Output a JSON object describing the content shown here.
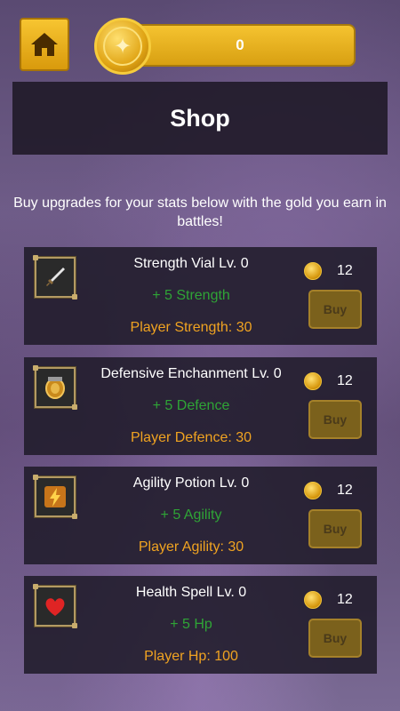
{
  "header": {
    "gold": "0"
  },
  "shop": {
    "title": "Shop",
    "description": "Buy upgrades for your stats below with the gold you earn in battles!"
  },
  "items": [
    {
      "title": "Strength Vial Lv. 0",
      "bonus": "+ 5 Strength",
      "stat": "Player Strength: 30",
      "price": "12",
      "buy_label": "Buy",
      "icon": "sword-icon"
    },
    {
      "title": "Defensive Enchanment Lv. 0",
      "bonus": "+ 5 Defence",
      "stat": "Player Defence: 30",
      "price": "12",
      "buy_label": "Buy",
      "icon": "shield-icon"
    },
    {
      "title": "Agility Potion Lv. 0",
      "bonus": "+ 5 Agility",
      "stat": "Player Agility: 30",
      "price": "12",
      "buy_label": "Buy",
      "icon": "lightning-icon"
    },
    {
      "title": "Health Spell Lv. 0",
      "bonus": "+ 5 Hp",
      "stat": "Player Hp: 100",
      "price": "12",
      "buy_label": "Buy",
      "icon": "heart-icon"
    }
  ],
  "colors": {
    "accent_gold": "#f5c330",
    "bonus_green": "#2fa436",
    "stat_orange": "#f0a321"
  }
}
